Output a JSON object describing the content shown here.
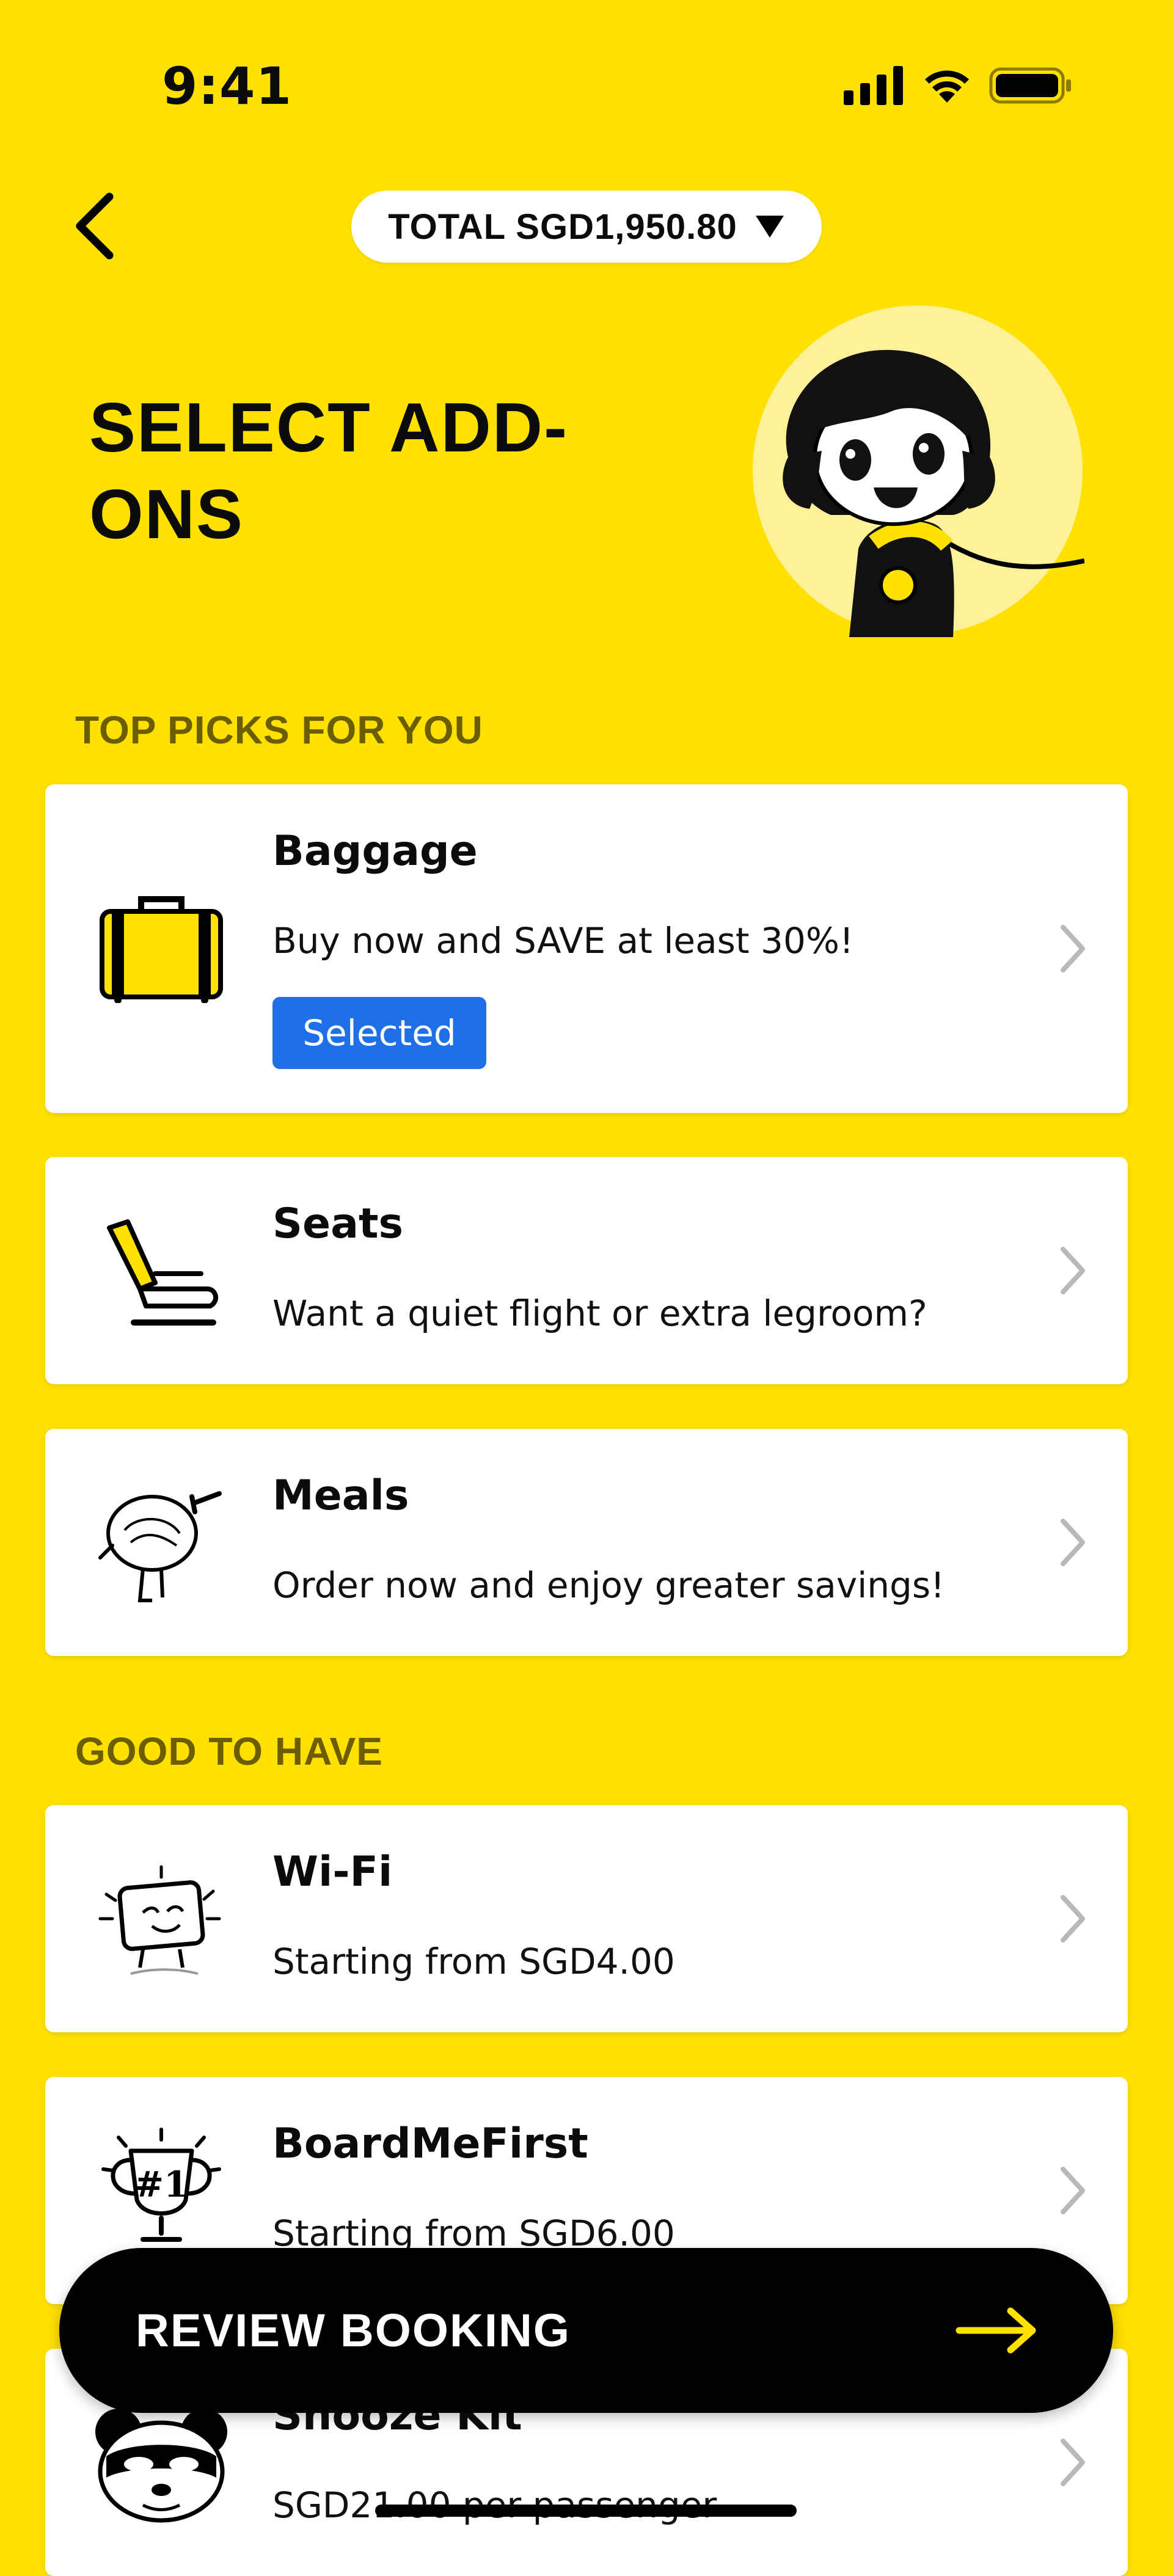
{
  "status_bar": {
    "time": "9:41"
  },
  "header": {
    "total_label": "TOTAL SGD1,950.80",
    "back_icon": "chevron-left-icon",
    "dropdown_icon": "triangle-down-icon"
  },
  "page": {
    "title": "SELECT ADD-ONS"
  },
  "sections": {
    "top_picks": "TOP PICKS FOR YOU",
    "good_to_have": "GOOD TO HAVE"
  },
  "cards": {
    "baggage": {
      "title": "Baggage",
      "subtitle": "Buy now and SAVE at least 30%!",
      "badge": "Selected",
      "icon": "suitcase-icon"
    },
    "seats": {
      "title": "Seats",
      "subtitle": "Want a quiet flight or extra legroom?",
      "icon": "seat-icon"
    },
    "meals": {
      "title": "Meals",
      "subtitle": "Order now and enjoy greater savings!",
      "icon": "meal-bowl-icon"
    },
    "wifi": {
      "title": "Wi-Fi",
      "subtitle": "Starting from SGD4.00",
      "icon": "tablet-icon"
    },
    "boardmefirst": {
      "title": "BoardMeFirst",
      "subtitle": "Starting from SGD6.00",
      "icon": "trophy-icon",
      "trophy_text": "#1"
    },
    "snooze": {
      "title": "Snooze Kit",
      "subtitle": "SGD21.00 per passenger",
      "icon": "sleep-mask-icon"
    }
  },
  "cta": {
    "label": "REVIEW BOOKING",
    "icon": "arrow-right-icon"
  },
  "colors": {
    "background": "#FFE100",
    "badge_blue": "#1f6fe8",
    "section_heading": "#6b5d00",
    "cta_background": "#000000",
    "cta_arrow": "#FFE100"
  }
}
